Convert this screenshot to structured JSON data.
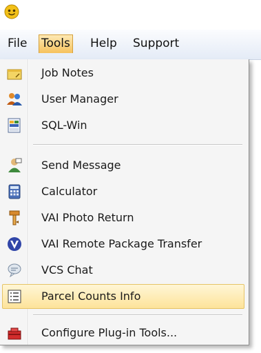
{
  "menubar": {
    "items": [
      {
        "label": "File",
        "active": false
      },
      {
        "label": "Tools",
        "active": true
      },
      {
        "label": "Help",
        "active": false
      },
      {
        "label": "Support",
        "active": false
      }
    ]
  },
  "tools_menu": {
    "items": [
      {
        "label": "Job Notes",
        "icon": "notes-icon"
      },
      {
        "label": "User Manager",
        "icon": "users-icon"
      },
      {
        "label": "SQL-Win",
        "icon": "sql-icon"
      },
      {
        "label": "Send Message",
        "icon": "message-icon"
      },
      {
        "label": "Calculator",
        "icon": "calculator-icon"
      },
      {
        "label": "VAI Photo Return",
        "icon": "photo-return-icon"
      },
      {
        "label": "VAI Remote Package Transfer",
        "icon": "vai-logo-icon"
      },
      {
        "label": "VCS Chat",
        "icon": "chat-icon"
      },
      {
        "label": "Parcel Counts Info",
        "icon": "list-icon",
        "highlighted": true
      },
      {
        "label": "Configure Plug-in Tools...",
        "icon": "plugin-tools-icon"
      }
    ]
  },
  "colors": {
    "menubar_active": "#f6c25d",
    "highlight": "#fde39a",
    "menu_background": "#f5f5f5"
  }
}
